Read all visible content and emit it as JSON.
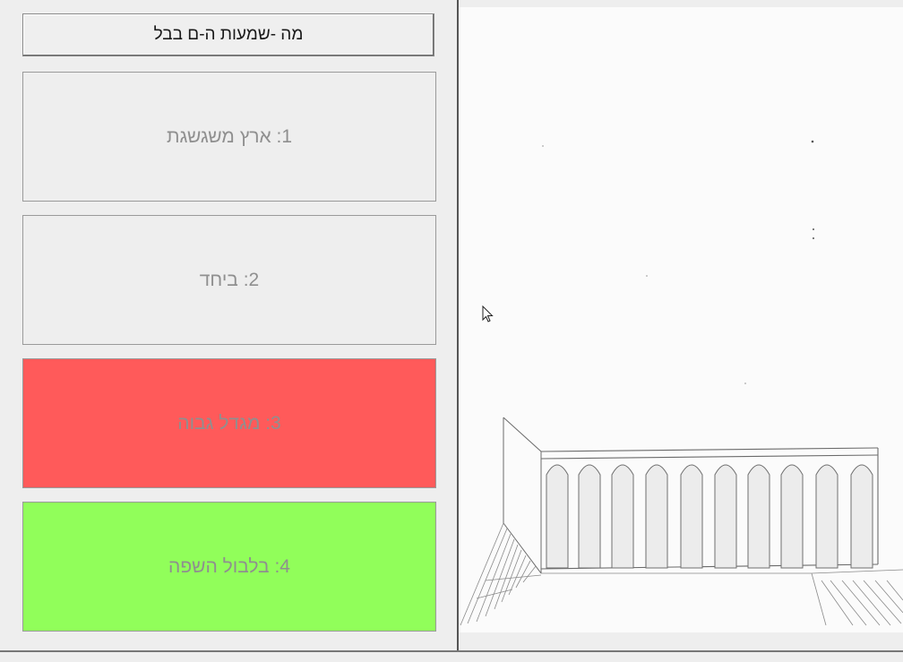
{
  "question": {
    "label": "מה  -שמעות  ה-ם  בבל"
  },
  "answers": [
    {
      "label": "1: ארץ משגשגת",
      "state": "neutral",
      "color": "#eeeeee"
    },
    {
      "label": "2: ביחד",
      "state": "neutral",
      "color": "#eeeeee"
    },
    {
      "label": "3: מגדל גבוה",
      "state": "wrong",
      "color": "#ff5a5a"
    },
    {
      "label": "4: בלבול השפה",
      "state": "correct",
      "color": "#91fe5a"
    }
  ],
  "image": {
    "icon": "pencil-sketch-arched-building"
  }
}
